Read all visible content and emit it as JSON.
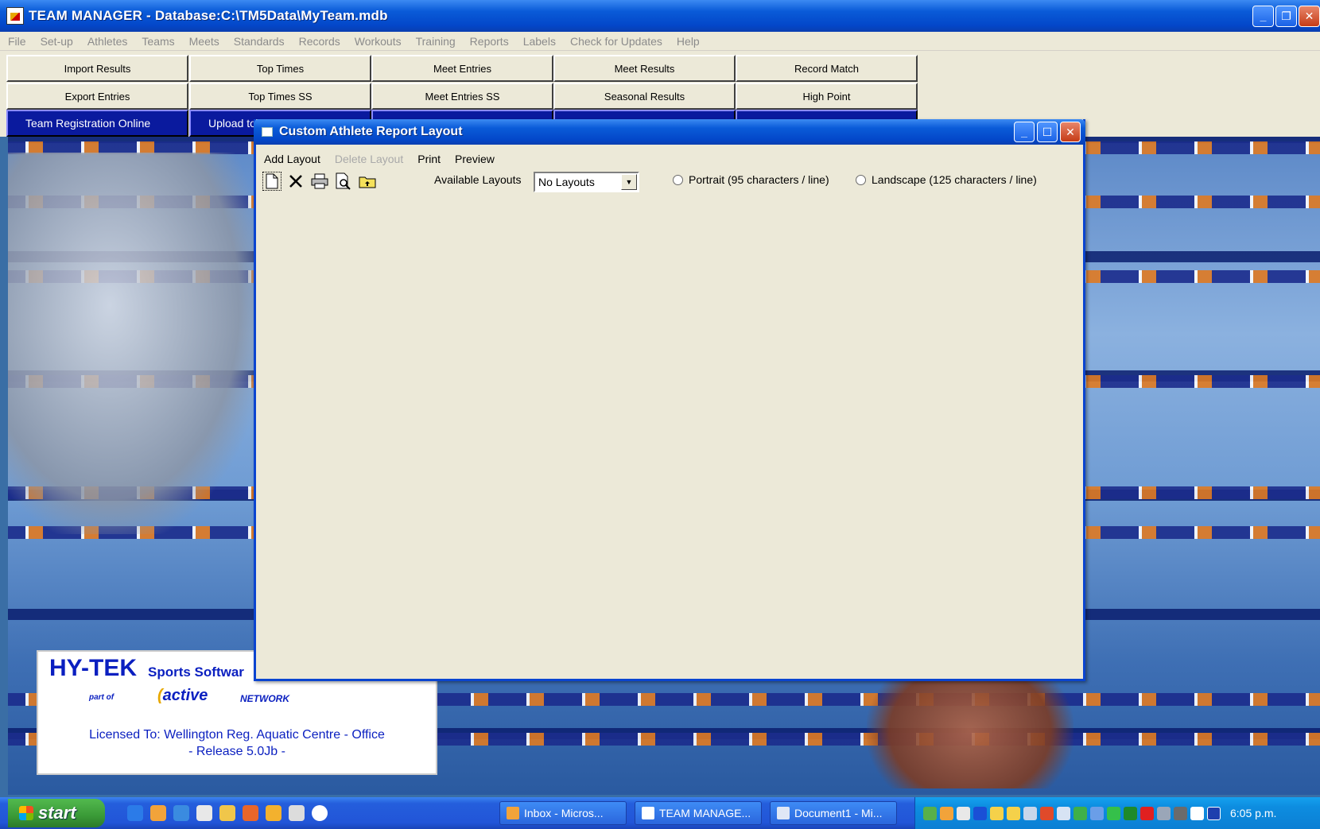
{
  "app": {
    "title": "TEAM MANAGER - Database:C:\\TM5Data\\MyTeam.mdb",
    "menu": [
      "File",
      "Set-up",
      "Athletes",
      "Teams",
      "Meets",
      "Standards",
      "Records",
      "Workouts",
      "Training",
      "Reports",
      "Labels",
      "Check for Updates",
      "Help"
    ]
  },
  "toolbar": {
    "row1": [
      "Import Results",
      "Top Times",
      "Meet Entries",
      "Meet Results",
      "Record Match"
    ],
    "row2": [
      "Export Entries",
      "Top Times SS",
      "Meet Entries SS",
      "Seasonal Results",
      "High Point"
    ],
    "row3": [
      "Team Registration Online",
      "Upload to"
    ]
  },
  "dialog": {
    "title": "Custom Athlete Report Layout",
    "menu": {
      "add_layout": "Add Layout",
      "delete_layout": "Delete Layout",
      "print": "Print",
      "preview": "Preview"
    },
    "tools": [
      "new-layout-icon",
      "delete-icon",
      "print-icon",
      "preview-icon",
      "open-folder-icon"
    ],
    "available_layouts_label": "Available Layouts",
    "available_layouts_value": "No Layouts",
    "portrait_label": "Portrait (95 characters / line)",
    "landscape_label": "Landscape (125 characters / line)"
  },
  "license": {
    "brand": "HY-TEK",
    "brand_sub": "Sports Softwar",
    "part_of": "part of",
    "active": "active",
    "network": "NETWORK",
    "licensed_to": "Licensed To:  Wellington Reg. Aquatic Centre - Office",
    "release": "- Release 5.0Jb -"
  },
  "taskbar": {
    "start": "start",
    "tasks": [
      "Inbox - Micros...",
      "TEAM MANAGE...",
      "Document1 - Mi..."
    ],
    "clock": "6:05 p.m."
  }
}
